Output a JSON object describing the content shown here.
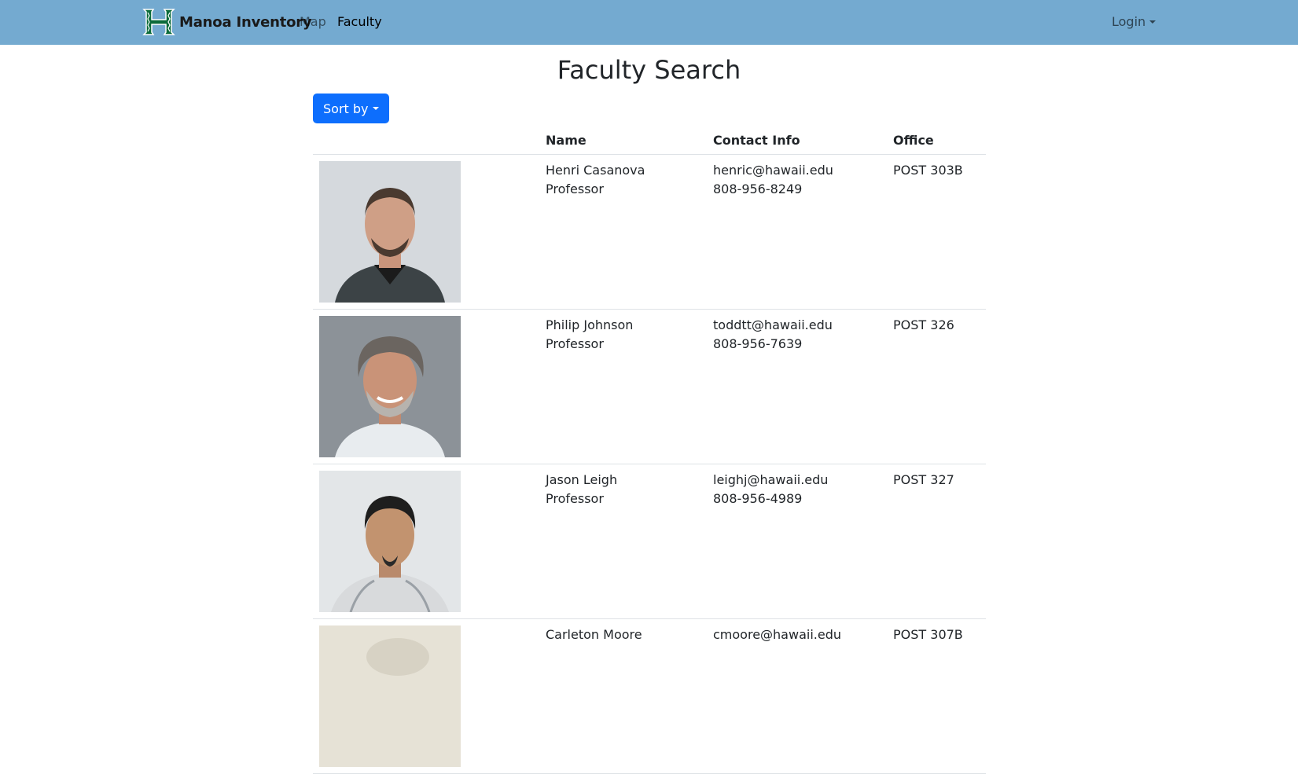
{
  "nav": {
    "brand": "Manoa Inventory",
    "links": {
      "map": "Map",
      "faculty": "Faculty"
    },
    "login": "Login",
    "logo_color": "#0b6b3a",
    "bar_color": "#74aad0"
  },
  "page": {
    "title": "Faculty Search",
    "sort_label": "Sort by"
  },
  "table": {
    "headers": {
      "name": "Name",
      "contact": "Contact Info",
      "office": "Office"
    },
    "rows": [
      {
        "name": "Henri Casanova",
        "title": "Professor",
        "email": "henric@hawaii.edu",
        "phone": "808-956-8249",
        "office": "POST 303B"
      },
      {
        "name": "Philip Johnson",
        "title": "Professor",
        "email": "toddtt@hawaii.edu",
        "phone": "808-956-7639",
        "office": "POST 326"
      },
      {
        "name": "Jason Leigh",
        "title": "Professor",
        "email": "leighj@hawaii.edu",
        "phone": "808-956-4989",
        "office": "POST 327"
      },
      {
        "name": "Carleton Moore",
        "title": "",
        "email": "cmoore@hawaii.edu",
        "phone": "",
        "office": "POST 307B"
      }
    ]
  },
  "colors": {
    "primary_button": "#0d6efd"
  }
}
